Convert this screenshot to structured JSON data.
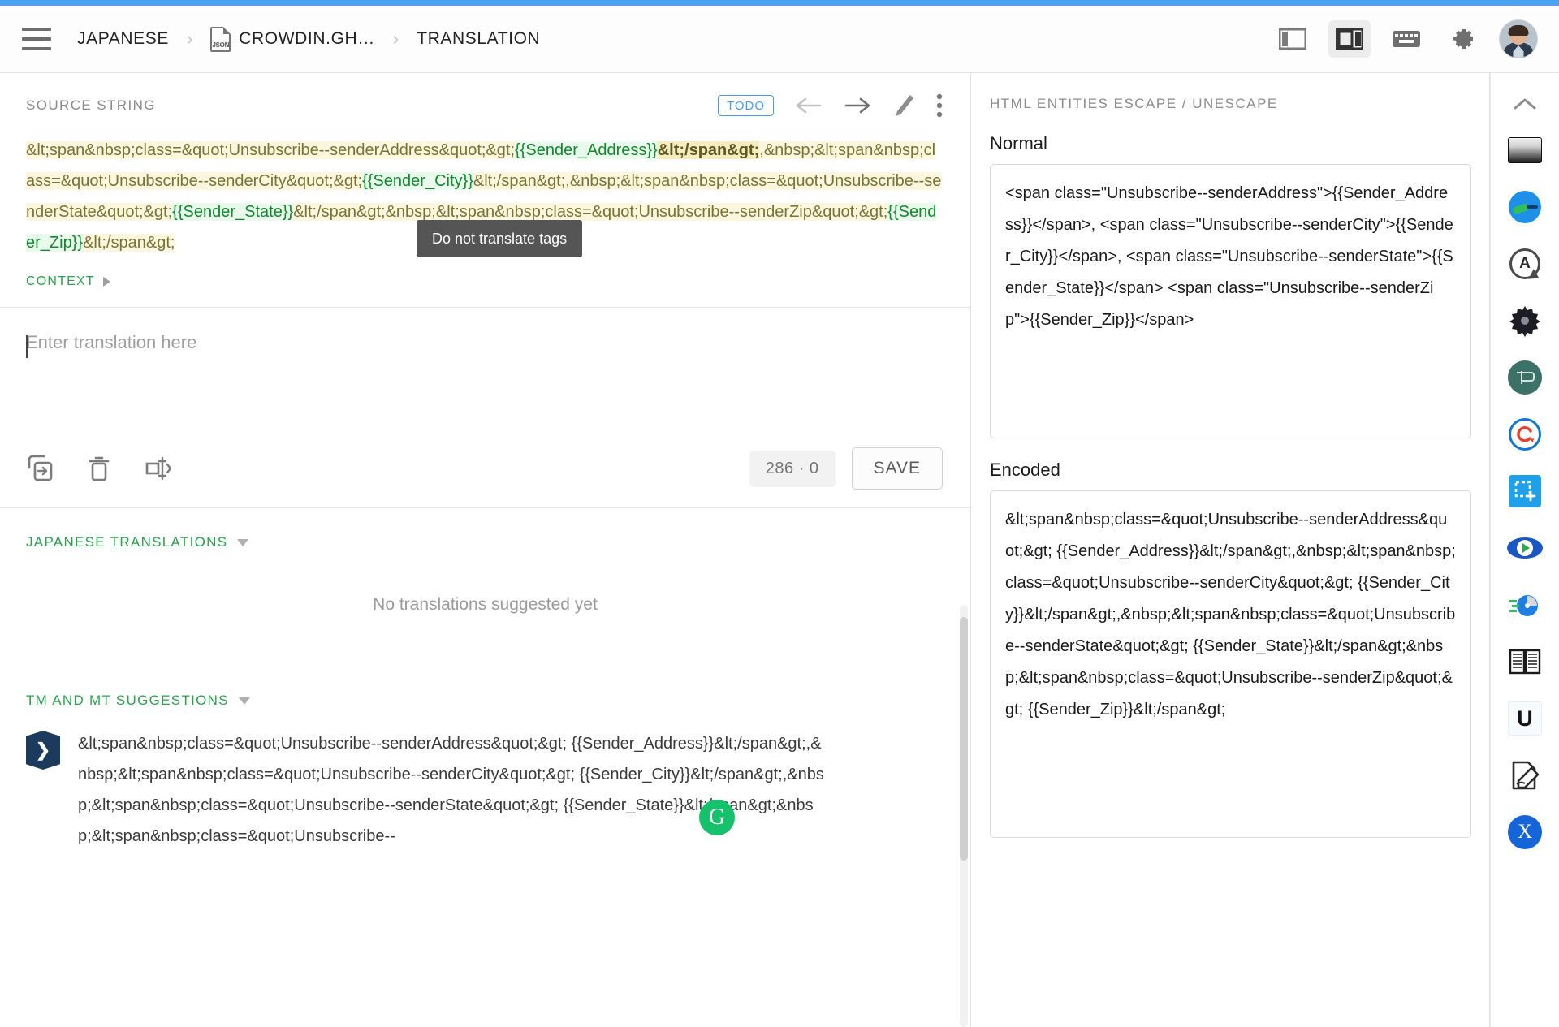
{
  "header": {
    "menu_icon": "hamburger-menu-icon",
    "breadcrumb": [
      {
        "label": "JAPANESE",
        "icon": null
      },
      {
        "label": "CROWDIN.GH…",
        "icon": "json-file-icon",
        "icon_text": "JSON"
      },
      {
        "label": "TRANSLATION",
        "icon": null
      }
    ],
    "right_icons": [
      {
        "name": "layout-left-panel-icon",
        "active": false
      },
      {
        "name": "layout-right-panel-icon",
        "active": true
      },
      {
        "name": "keyboard-shortcuts-icon",
        "active": false
      },
      {
        "name": "settings-gear-icon",
        "active": false
      },
      {
        "name": "user-avatar",
        "active": false
      }
    ]
  },
  "source": {
    "title": "SOURCE STRING",
    "status_badge": "TODO",
    "actions": [
      "previous-string-arrow",
      "next-string-arrow",
      "edit-pencil",
      "more-options-kebab"
    ],
    "tooltip": "Do not translate tags",
    "context_label": "CONTEXT",
    "segments": [
      {
        "text": "&lt;span&nbsp;class=&quot;Unsubscribe--senderAddress&quot;&gt;",
        "type": "tag"
      },
      {
        "text": "{{Sender_Address}}",
        "type": "placeholder"
      },
      {
        "text": "&lt;/span&gt;",
        "type": "tag-hover"
      },
      {
        "text": ",&nbsp;",
        "type": "tag"
      },
      {
        "text": "&lt;span&nbsp;class=&quot;Unsubscribe--senderCity&quot;&gt;",
        "type": "tag"
      },
      {
        "text": "{{Sender_City}}",
        "type": "placeholder"
      },
      {
        "text": "&lt;/span&gt;",
        "type": "tag"
      },
      {
        "text": ",&nbsp;",
        "type": "tag"
      },
      {
        "text": "&lt;span&nbsp;class=&quot;Unsubscribe--senderState&quot;&gt;",
        "type": "tag"
      },
      {
        "text": "{{Sender_State}}",
        "type": "placeholder"
      },
      {
        "text": "&lt;/span&gt;",
        "type": "tag"
      },
      {
        "text": "&nbsp;",
        "type": "tag"
      },
      {
        "text": "&lt;span&nbsp;class=&quot;Unsubscribe--senderZip&quot;&gt;",
        "type": "tag"
      },
      {
        "text": "{{Sender_Zip}}",
        "type": "placeholder"
      },
      {
        "text": "&lt;/span&gt;",
        "type": "tag"
      }
    ]
  },
  "editor": {
    "placeholder": "Enter translation here",
    "value": "",
    "tools": [
      "copy-source-icon",
      "delete-icon",
      "clear-tm-icon"
    ],
    "counter": "286 · 0",
    "save_label": "SAVE"
  },
  "translations_section": {
    "label": "JAPANESE TRANSLATIONS",
    "empty_message": "No translations suggested yet"
  },
  "tm_section": {
    "label": "TM AND MT SUGGESTIONS",
    "items": [
      {
        "badge_icon": "tm-source-badge-icon",
        "provider_icon": "grammarly-green-icon",
        "text": "&lt;span&nbsp;class=&quot;Unsubscribe--senderAddress&quot;&gt; {{Sender_Address}}&lt;/span&gt;,&nbsp;&lt;span&nbsp;class=&quot;Unsubscribe--senderCity&quot;&gt; {{Sender_City}}&lt;/span&gt;,&nbsp;&lt;span&nbsp;class=&quot;Unsubscribe--senderState&quot;&gt; {{Sender_State}}&lt;/span&gt;&nbsp;&lt;span&nbsp;class=&quot;Unsubscribe--"
      }
    ]
  },
  "right_panel": {
    "title": "HTML ENTITIES ESCAPE / UNESCAPE",
    "normal_label": "Normal",
    "normal_value": "<span class=\"Unsubscribe--senderAddress\">{{Sender_Address}}</span>, <span class=\"Unsubscribe--senderCity\">{{Sender_City}}</span>, <span class=\"Unsubscribe--senderState\">{{Sender_State}}</span> <span class=\"Unsubscribe--senderZip\">{{Sender_Zip}}</span>",
    "encoded_label": "Encoded",
    "encoded_value": "&lt;span&nbsp;class=&quot;Unsubscribe--senderAddress&quot;&gt; {{Sender_Address}}&lt;/span&gt;,&nbsp;&lt;span&nbsp;class=&quot;Unsubscribe--senderCity&quot;&gt; {{Sender_City}}&lt;/span&gt;,&nbsp;&lt;span&nbsp;class=&quot;Unsubscribe--senderState&quot;&gt; {{Sender_State}}&lt;/span&gt;&nbsp;&lt;span&nbsp;class=&quot;Unsubscribe--senderZip&quot;&gt; {{Sender_Zip}}&lt;/span&gt;"
  },
  "icon_rail": {
    "collapse_icon": "chevron-up-icon",
    "items": [
      {
        "name": "screen-recorder-icon"
      },
      {
        "name": "speedometer-extension-icon"
      },
      {
        "name": "ally-audit-icon",
        "glyph": "A"
      },
      {
        "name": "dark-gear-extension-icon"
      },
      {
        "name": "pocket-flag-icon"
      },
      {
        "name": "sync-refresh-icon"
      },
      {
        "name": "screenshot-capture-icon"
      },
      {
        "name": "eye-preview-icon"
      },
      {
        "name": "page-speed-icon"
      },
      {
        "name": "readability-book-icon"
      },
      {
        "name": "unicode-u-icon",
        "glyph": "U"
      },
      {
        "name": "edit-document-icon"
      },
      {
        "name": "x-blue-icon",
        "glyph": "X"
      }
    ]
  },
  "colors": {
    "accent_blue": "#4ba3f5",
    "tag_bg": "#fbf6dd",
    "tag_text": "#7a7434",
    "placeholder_bg": "#e9f9ec",
    "placeholder_text": "#12892f",
    "green_label": "#2aa14c",
    "tooltip_bg": "#555555"
  }
}
